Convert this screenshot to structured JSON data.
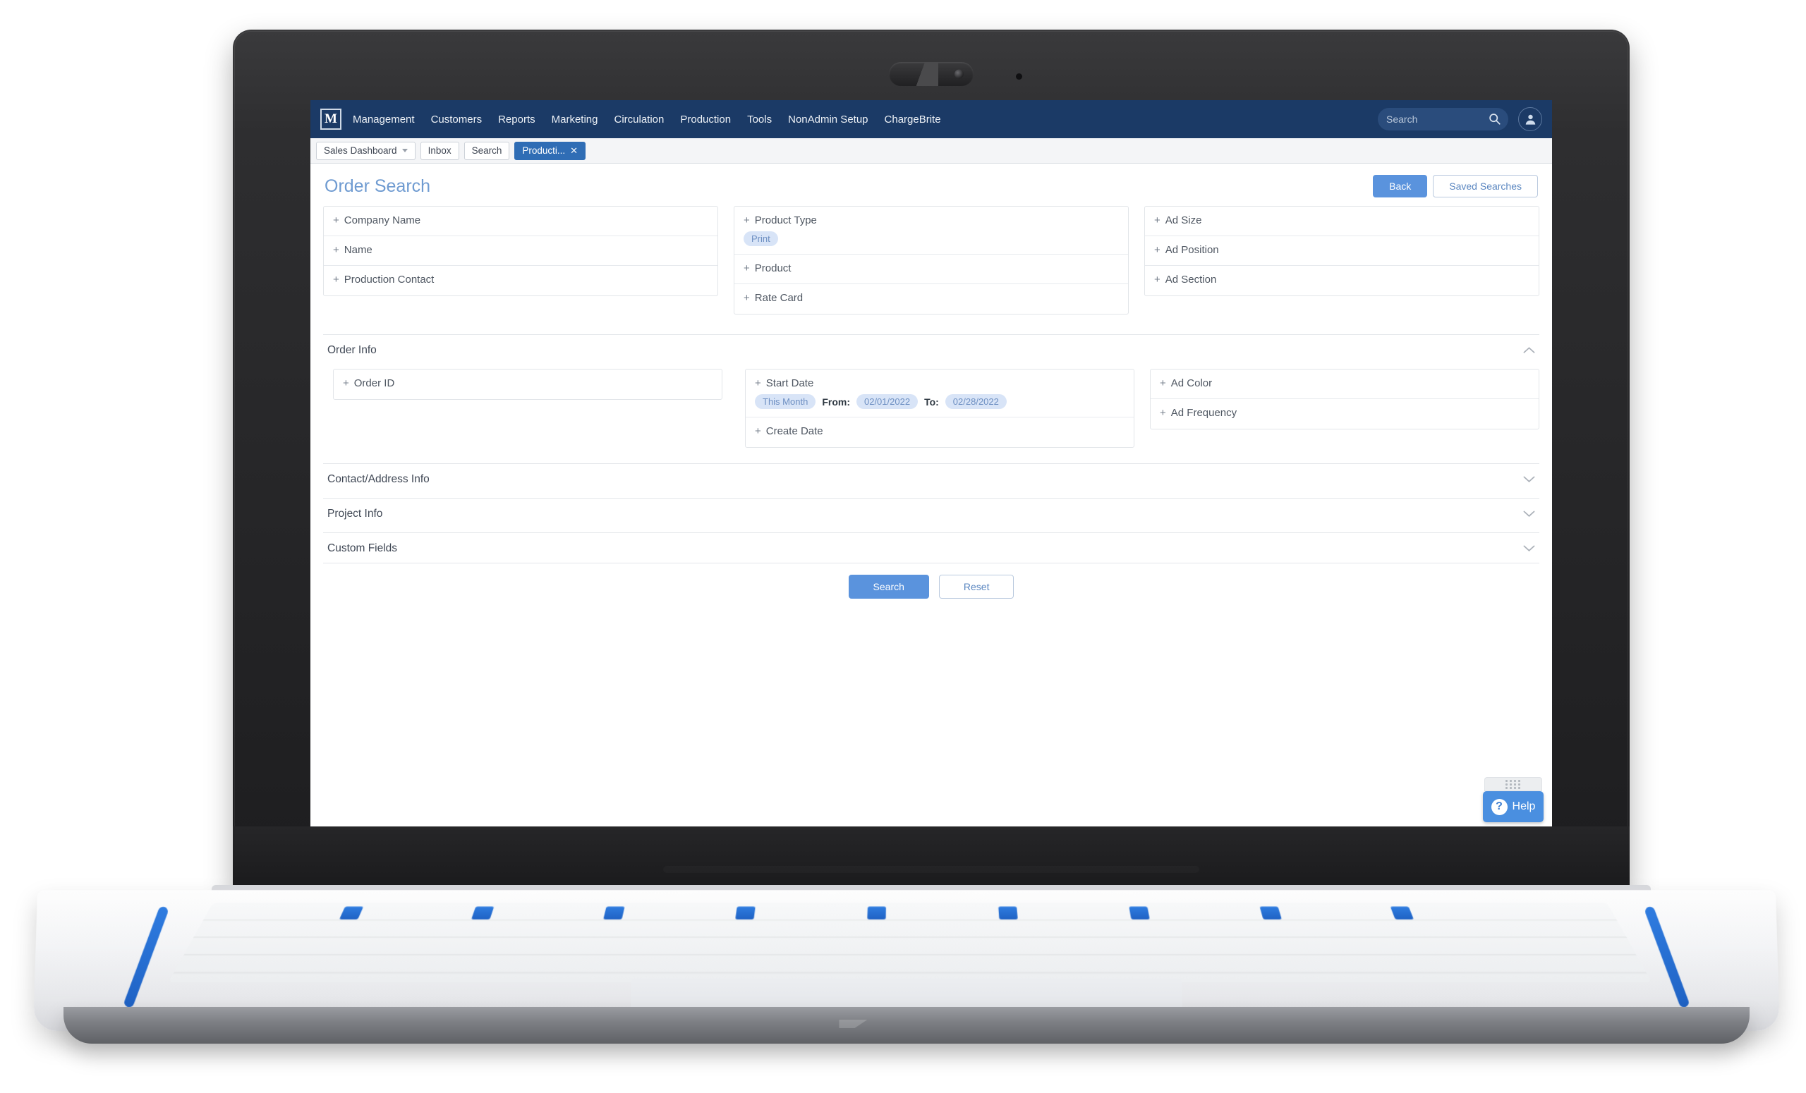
{
  "navbar": {
    "logo": "M",
    "menu": [
      "Management",
      "Customers",
      "Reports",
      "Marketing",
      "Circulation",
      "Production",
      "Tools",
      "NonAdmin Setup",
      "ChargeBrite"
    ],
    "search_placeholder": "Search",
    "search_value": ""
  },
  "tabs": [
    {
      "label": "Sales Dashboard",
      "active": false,
      "has_caret": true,
      "closable": false
    },
    {
      "label": "Inbox",
      "active": false,
      "has_caret": false,
      "closable": false
    },
    {
      "label": "Search",
      "active": false,
      "has_caret": false,
      "closable": false
    },
    {
      "label": "Producti...",
      "active": true,
      "has_caret": false,
      "closable": true
    }
  ],
  "page": {
    "title": "Order Search",
    "back_label": "Back",
    "saved_searches_label": "Saved Searches"
  },
  "criteria": {
    "column1": [
      {
        "label": "Company Name"
      },
      {
        "label": "Name"
      },
      {
        "label": "Production Contact"
      }
    ],
    "column2": [
      {
        "label": "Product Type",
        "chips": [
          "Print"
        ]
      },
      {
        "label": "Product"
      },
      {
        "label": "Rate Card"
      }
    ],
    "column3": [
      {
        "label": "Ad Size"
      },
      {
        "label": "Ad Position"
      },
      {
        "label": "Ad Section"
      }
    ]
  },
  "order_info": {
    "title": "Order Info",
    "expanded": true,
    "chevron": "up",
    "column1": [
      {
        "label": "Order ID"
      }
    ],
    "column2": [
      {
        "label": "Start Date",
        "preset": "This Month",
        "from_label": "From:",
        "from_value": "02/01/2022",
        "to_label": "To:",
        "to_value": "02/28/2022"
      },
      {
        "label": "Create Date"
      }
    ],
    "column3": [
      {
        "label": "Ad Color"
      },
      {
        "label": "Ad Frequency"
      }
    ]
  },
  "collapsed_sections": [
    {
      "title": "Contact/Address Info",
      "chevron": "down"
    },
    {
      "title": "Project Info",
      "chevron": "down"
    },
    {
      "title": "Custom Fields",
      "chevron": "down"
    }
  ],
  "footer": {
    "search_label": "Search",
    "reset_label": "Reset"
  },
  "help": {
    "label": "Help",
    "icon_glyph": "?"
  },
  "colors": {
    "navbar_bg": "#1b3a66",
    "accent_blue": "#5a93dd",
    "active_tab": "#2f6db5",
    "title_blue": "#6f9bd1",
    "chip_bg": "#d8e4f7",
    "chip_text": "#6d8fc2"
  }
}
